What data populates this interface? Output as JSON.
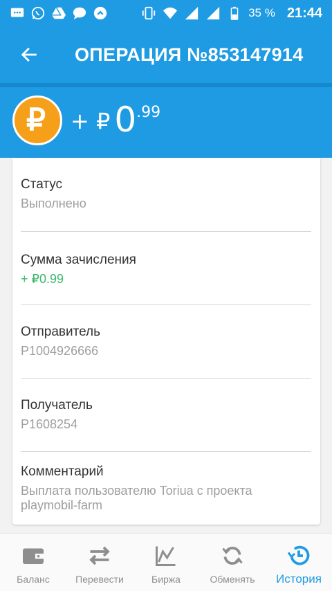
{
  "status_bar": {
    "battery_percent": "35 %",
    "time": "21:44",
    "icons": [
      "messages-icon",
      "whatsapp-icon",
      "drive-icon",
      "chat-icon",
      "sync-icon",
      "vibrate-icon",
      "wifi-icon",
      "signal-icon",
      "signal-icon",
      "battery-icon"
    ]
  },
  "app_bar": {
    "title": "ОПЕРАЦИЯ №853147914",
    "back_icon": "arrow-back-icon"
  },
  "amount": {
    "sign": "+ ₽",
    "integer": "0",
    "fraction": ".99",
    "coin_letter": "₽",
    "coin_color": "#f6a01a"
  },
  "details": [
    {
      "label": "Статус",
      "value": "Выполнено"
    },
    {
      "label": "Сумма зачисления",
      "value": "+ ₽0.99"
    },
    {
      "label": "Отправитель",
      "value": "P1004926666"
    },
    {
      "label": "Получатель",
      "value": "P1608254"
    },
    {
      "label": "Комментарий",
      "value": "Выплата пользователю Toriua с проекта playmobil-farm"
    }
  ],
  "bottom_nav": [
    {
      "label": "Баланс",
      "icon": "wallet-icon",
      "active": false
    },
    {
      "label": "Перевести",
      "icon": "transfer-icon",
      "active": false
    },
    {
      "label": "Биржа",
      "icon": "chart-icon",
      "active": false
    },
    {
      "label": "Обменять",
      "icon": "exchange-icon",
      "active": false
    },
    {
      "label": "История",
      "icon": "history-icon",
      "active": true
    }
  ],
  "colors": {
    "primary": "#1e9be3",
    "positive": "#3db86b",
    "muted": "#9e9e9e"
  }
}
